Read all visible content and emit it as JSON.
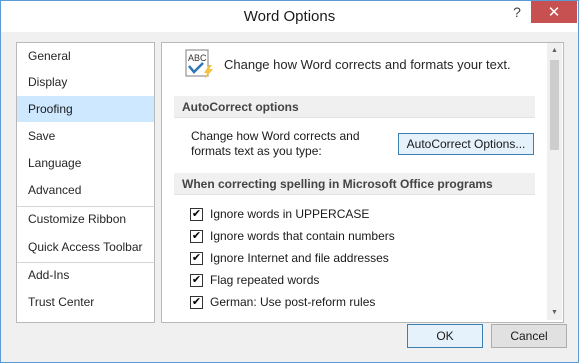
{
  "window": {
    "title": "Word Options",
    "help_glyph": "?",
    "close_glyph": "✕"
  },
  "sidebar": {
    "items": [
      {
        "label": "General"
      },
      {
        "label": "Display"
      },
      {
        "label": "Proofing",
        "active": true
      },
      {
        "label": "Save"
      },
      {
        "label": "Language"
      },
      {
        "label": "Advanced"
      },
      {
        "label": "Customize Ribbon"
      },
      {
        "label": "Quick Access Toolbar"
      },
      {
        "label": "Add-Ins"
      },
      {
        "label": "Trust Center"
      }
    ]
  },
  "main": {
    "heading": "Change how Word corrects and formats your text.",
    "icon_text": "ABC",
    "autocorrect": {
      "section_title": "AutoCorrect options",
      "description_line1": "Change how Word corrects and",
      "description_line2": "formats text as you type:",
      "button_label": "AutoCorrect Options..."
    },
    "spelling": {
      "section_title": "When correcting spelling in Microsoft Office programs",
      "options": [
        {
          "label": "Ignore words in UPPERCASE",
          "checked": true
        },
        {
          "label": "Ignore words that contain numbers",
          "checked": true
        },
        {
          "label": "Ignore Internet and file addresses",
          "checked": true
        },
        {
          "label": "Flag repeated words",
          "checked": true
        },
        {
          "label": "German: Use post-reform rules",
          "checked": true
        }
      ]
    }
  },
  "footer": {
    "ok_label": "OK",
    "cancel_label": "Cancel"
  },
  "colors": {
    "accent": "#5b9bd5",
    "close_button": "#c75050",
    "selected_item": "#cde8ff"
  }
}
